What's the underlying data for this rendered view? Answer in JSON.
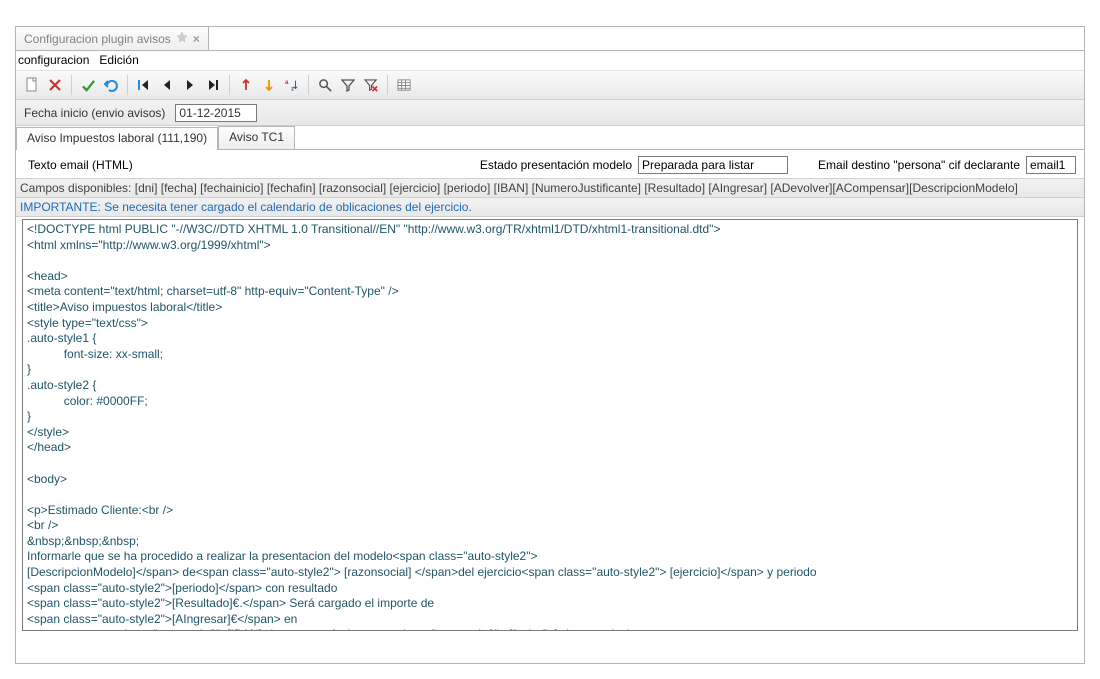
{
  "window": {
    "tab_title": "Configuracion plugin avisos"
  },
  "menus": {
    "config": "configuracion",
    "edicion": "Edición"
  },
  "date_row": {
    "label": "Fecha inicio (envio avisos)",
    "value": "01-12-2015"
  },
  "tabs": {
    "t1": "Aviso Impuestos laboral (111,190)",
    "t2": "Aviso TC1"
  },
  "form": {
    "texto_label": "Texto email (HTML)",
    "estado_label": "Estado presentación modelo",
    "estado_value": "Preparada para listar",
    "email_label": "Email destino \"persona\" cif declarante",
    "email_value": "email1"
  },
  "fields_bar": {
    "prefix": "Campos disponibles:",
    "list": "[dni] [fecha] [fechainicio] [fechafin] [razonsocial] [ejercicio] [periodo] [IBAN] [NumeroJustificante] [Resultado] [AIngresar] [ADevolver][ACompensar][DescripcionModelo]"
  },
  "important": "IMPORTANTE: Se necesita tener cargado el calendario de oblicaciones del ejercicio.",
  "editor": "<!DOCTYPE html PUBLIC \"-//W3C//DTD XHTML 1.0 Transitional//EN\" \"http://www.w3.org/TR/xhtml1/DTD/xhtml1-transitional.dtd\">\n<html xmlns=\"http://www.w3.org/1999/xhtml\">\n\n<head>\n<meta content=\"text/html; charset=utf-8\" http-equiv=\"Content-Type\" />\n<title>Aviso impuestos laboral</title>\n<style type=\"text/css\">\n.auto-style1 {\n           font-size: xx-small;\n}\n.auto-style2 {\n           color: #0000FF;\n}\n</style>\n</head>\n\n<body>\n\n<p>Estimado Cliente:<br />\n<br />\n&nbsp;&nbsp;&nbsp;\nInformarle que se ha procedido a realizar la presentacion del modelo<span class=\"auto-style2\">\n[DescripcionModelo]</span> de<span class=\"auto-style2\"> [razonsocial] </span>del ejercicio<span class=\"auto-style2\"> [ejercicio]</span> y periodo\n<span class=\"auto-style2\">[periodo]</span> con resultado\n<span class=\"auto-style2\">[Resultado]€.</span> Será cargado el importe de\n<span class=\"auto-style2\">[AIngresar]€</span> en\nsu cuenta <span class=\"auto-style2\">[IBAN]</span> con fecha<span class=\"auto-style2\"> [fechafin]</span>.<br />\n<br />\n&nbsp;&nbsp;&nbsp;"
}
